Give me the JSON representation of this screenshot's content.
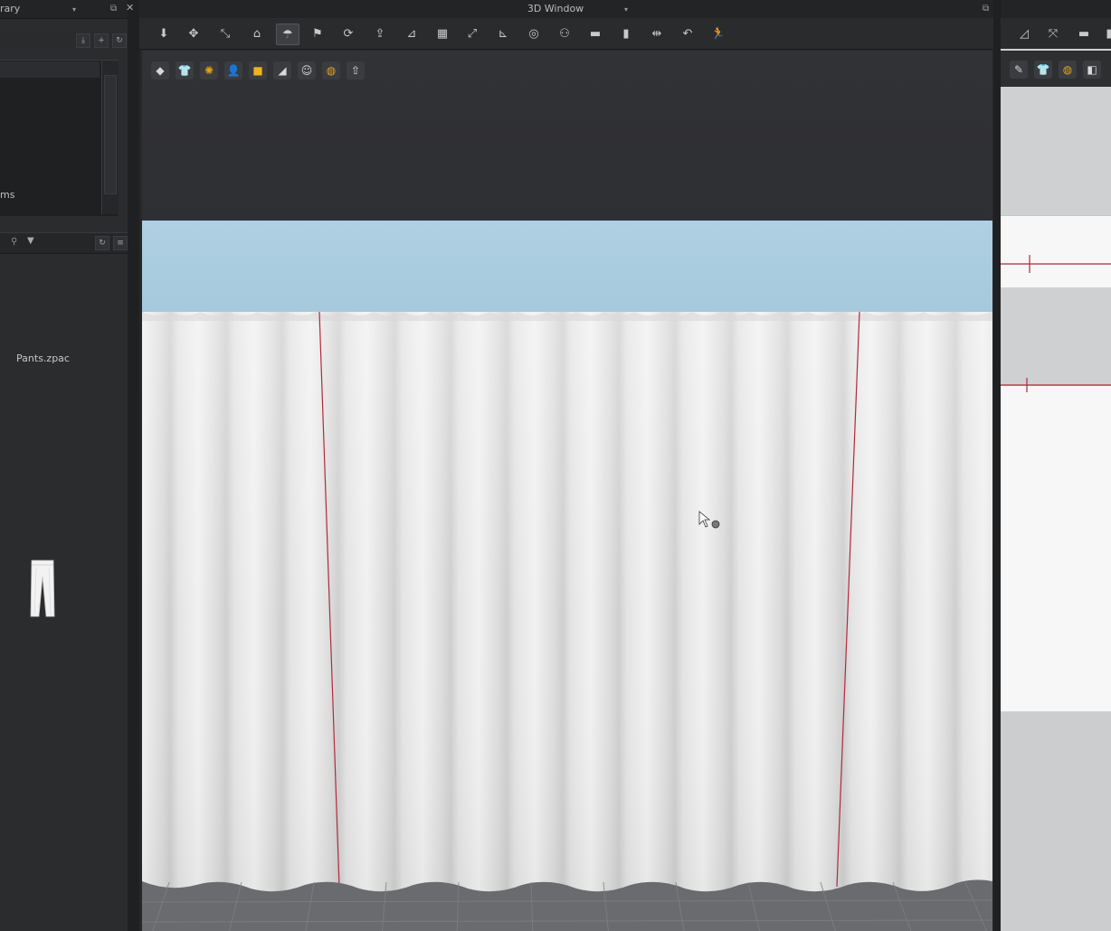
{
  "left_panel": {
    "title": "rary",
    "tree_label": "ms",
    "file": {
      "name": "Pants.zpac",
      "icon": "pants-icon"
    }
  },
  "window": {
    "title": "3D Window",
    "toolbar_icons": [
      "move-pin-icon",
      "translate-icon",
      "transform-icon",
      "fold-icon",
      "select-mesh-icon",
      "arrange-icon",
      "tack-icon",
      "arrow-point-icon",
      "sew-icon",
      "grid-icon",
      "pin-icon",
      "measure-icon",
      "target-icon",
      "avatar-icon",
      "flat-icon",
      "bar-icon",
      "fit-icon",
      "tape-icon",
      "run-icon"
    ],
    "overlay_icons": [
      "fabric-icon",
      "garment-icon",
      "sun-icon",
      "avatar-silhouette-icon",
      "texture-icon",
      "stage-icon",
      "head-icon",
      "globe-icon",
      "export-icon"
    ]
  },
  "right_panel": {
    "icons": [
      "eye-icon",
      "shirt-icon",
      "material-icon",
      "plane-icon"
    ]
  },
  "colors": {
    "bg": "#262729",
    "band": "#aed0e2",
    "fabric": "#e8e8e8",
    "seam": "#b02a3a",
    "accent": "#e6a317"
  }
}
